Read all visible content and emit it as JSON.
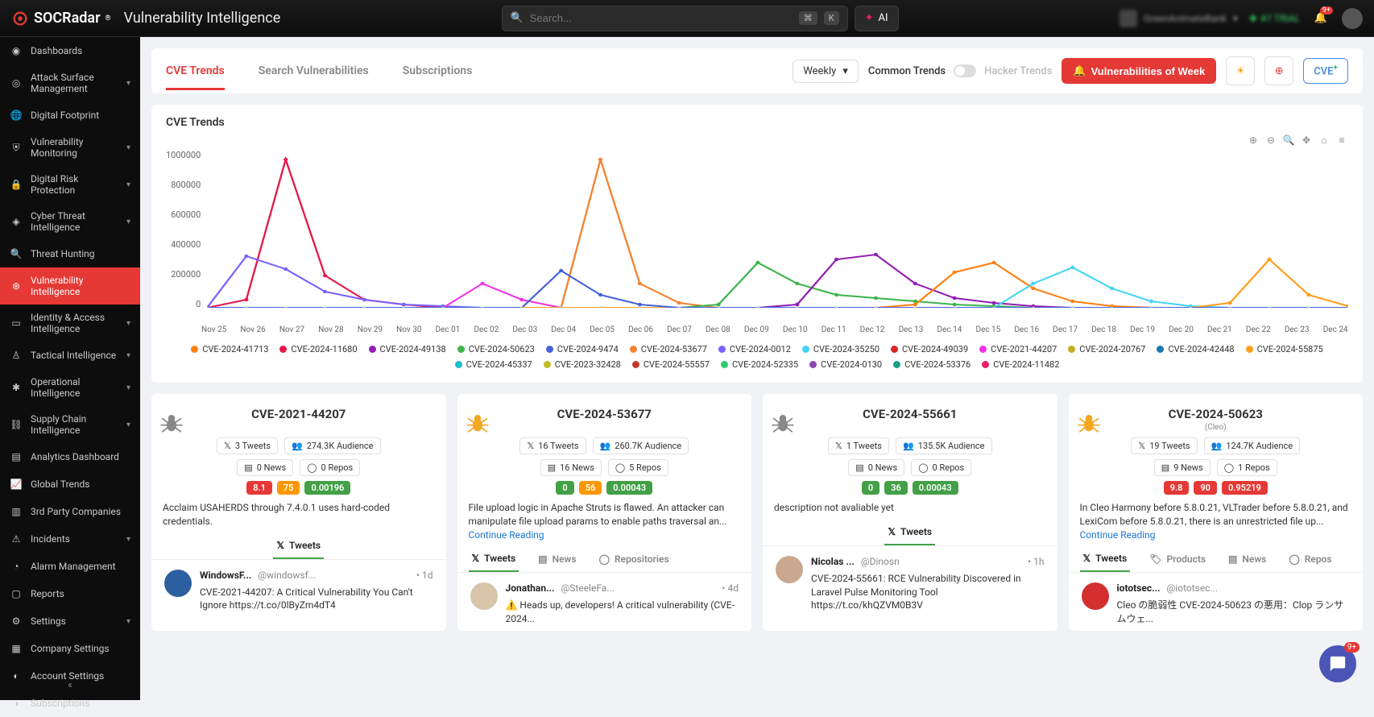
{
  "brand": "SOCRadar",
  "page_title": "Vulnerability Intelligence",
  "search": {
    "placeholder": "Search...",
    "kbd1": "⌘",
    "kbd2": "K",
    "ai": "AI"
  },
  "top": {
    "org": "GreenAnimateBank",
    "trial": "#7 TRIAL",
    "notif": "9+"
  },
  "sidebar": [
    {
      "label": "Dashboards",
      "icon": "gauge"
    },
    {
      "label": "Attack Surface Management",
      "icon": "target",
      "chev": true
    },
    {
      "label": "Digital Footprint",
      "icon": "globe"
    },
    {
      "label": "Vulnerability Monitoring",
      "icon": "shield",
      "chev": true
    },
    {
      "label": "Digital Risk Protection",
      "icon": "lock",
      "chev": true
    },
    {
      "label": "Cyber Threat Intelligence",
      "icon": "radar",
      "chev": true
    },
    {
      "label": "Threat Hunting",
      "icon": "search"
    },
    {
      "label": "Vulnerability Intelligence",
      "icon": "bug",
      "active": true
    },
    {
      "label": "Identity & Access Intelligence",
      "icon": "id",
      "chev": true
    },
    {
      "label": "Tactical Intelligence",
      "icon": "chess",
      "chev": true
    },
    {
      "label": "Operational Intelligence",
      "icon": "gear",
      "chev": true
    },
    {
      "label": "Supply Chain Intelligence",
      "icon": "link",
      "chev": true
    },
    {
      "label": "Analytics Dashboard",
      "icon": "chart"
    },
    {
      "label": "Global Trends",
      "icon": "trend"
    },
    {
      "label": "3rd Party Companies",
      "icon": "building"
    },
    {
      "label": "Incidents",
      "icon": "alert",
      "chev": true
    },
    {
      "label": "Alarm Management",
      "icon": "bell"
    },
    {
      "label": "Reports",
      "icon": "doc"
    },
    {
      "label": "Settings",
      "icon": "cog",
      "chev": true
    },
    {
      "label": "Company Settings",
      "icon": "company"
    },
    {
      "label": "Account Settings",
      "icon": "user"
    },
    {
      "label": "Subscriptions",
      "icon": "sub"
    }
  ],
  "tabs": {
    "items": [
      "CVE Trends",
      "Search Vulnerabilities",
      "Subscriptions"
    ],
    "active": 0
  },
  "controls": {
    "range": "Weekly",
    "common": "Common Trends",
    "hacker": "Hacker Trends",
    "vuln_week": "Vulnerabilities of Week",
    "cve": "CVE"
  },
  "chart": {
    "title": "CVE Trends",
    "y_ticks": [
      "1000000",
      "800000",
      "600000",
      "400000",
      "200000",
      "0"
    ],
    "x_ticks": [
      "Nov 25",
      "Nov 26",
      "Nov 27",
      "Nov 28",
      "Nov 29",
      "Nov 30",
      "Dec 01",
      "Dec 02",
      "Dec 03",
      "Dec 04",
      "Dec 05",
      "Dec 06",
      "Dec 07",
      "Dec 08",
      "Dec 09",
      "Dec 10",
      "Dec 11",
      "Dec 12",
      "Dec 13",
      "Dec 14",
      "Dec 15",
      "Dec 16",
      "Dec 17",
      "Dec 18",
      "Dec 19",
      "Dec 20",
      "Dec 21",
      "Dec 22",
      "Dec 23",
      "Dec 24"
    ],
    "legend": [
      {
        "label": "CVE-2024-41713",
        "color": "#ff7f0e"
      },
      {
        "label": "CVE-2024-11680",
        "color": "#e6194B"
      },
      {
        "label": "CVE-2024-49138",
        "color": "#911eb4"
      },
      {
        "label": "CVE-2024-50623",
        "color": "#3cb44b"
      },
      {
        "label": "CVE-2024-9474",
        "color": "#4363d8"
      },
      {
        "label": "CVE-2024-53677",
        "color": "#f58231"
      },
      {
        "label": "CVE-2024-0012",
        "color": "#7b61ff"
      },
      {
        "label": "CVE-2024-35250",
        "color": "#42d4f4"
      },
      {
        "label": "CVE-2024-49039",
        "color": "#d62728"
      },
      {
        "label": "CVE-2021-44207",
        "color": "#f032e6"
      },
      {
        "label": "CVE-2024-20767",
        "color": "#bfae1f"
      },
      {
        "label": "CVE-2024-42448",
        "color": "#1f77b4"
      },
      {
        "label": "CVE-2024-55875",
        "color": "#ff9e1b"
      },
      {
        "label": "CVE-2024-45337",
        "color": "#17becf"
      },
      {
        "label": "CVE-2023-32428",
        "color": "#bcbd22"
      },
      {
        "label": "CVE-2024-55557",
        "color": "#c0392b"
      },
      {
        "label": "CVE-2024-52335",
        "color": "#2ecc71"
      },
      {
        "label": "CVE-2024-0130",
        "color": "#8e44ad"
      },
      {
        "label": "CVE-2024-53376",
        "color": "#16a085"
      },
      {
        "label": "CVE-2024-11482",
        "color": "#e91e63"
      }
    ]
  },
  "chart_data": {
    "type": "line",
    "title": "CVE Trends",
    "xlabel": "",
    "ylabel": "",
    "ylim": [
      0,
      1000000
    ],
    "categories": [
      "Nov 25",
      "Nov 26",
      "Nov 27",
      "Nov 28",
      "Nov 29",
      "Nov 30",
      "Dec 01",
      "Dec 02",
      "Dec 03",
      "Dec 04",
      "Dec 05",
      "Dec 06",
      "Dec 07",
      "Dec 08",
      "Dec 09",
      "Dec 10",
      "Dec 11",
      "Dec 12",
      "Dec 13",
      "Dec 14",
      "Dec 15",
      "Dec 16",
      "Dec 17",
      "Dec 18",
      "Dec 19",
      "Dec 20",
      "Dec 21",
      "Dec 22",
      "Dec 23",
      "Dec 24"
    ],
    "series": [
      {
        "name": "CVE-2024-11680",
        "values": [
          0,
          50000,
          920000,
          200000,
          50000,
          20000,
          0,
          0,
          0,
          0,
          0,
          0,
          0,
          0,
          0,
          0,
          0,
          0,
          0,
          0,
          0,
          0,
          0,
          0,
          0,
          0,
          0,
          0,
          0,
          0
        ]
      },
      {
        "name": "CVE-2024-53677",
        "values": [
          0,
          0,
          0,
          0,
          0,
          0,
          0,
          0,
          0,
          0,
          920000,
          150000,
          30000,
          0,
          0,
          0,
          0,
          0,
          0,
          0,
          0,
          0,
          0,
          0,
          0,
          0,
          0,
          0,
          0,
          0
        ]
      },
      {
        "name": "CVE-2024-0012",
        "values": [
          0,
          320000,
          240000,
          100000,
          50000,
          20000,
          10000,
          0,
          0,
          0,
          0,
          0,
          0,
          0,
          0,
          0,
          0,
          0,
          0,
          0,
          0,
          0,
          0,
          0,
          0,
          0,
          0,
          0,
          0,
          0
        ]
      },
      {
        "name": "CVE-2024-50623",
        "values": [
          0,
          0,
          0,
          0,
          0,
          0,
          0,
          0,
          0,
          0,
          0,
          0,
          0,
          20000,
          280000,
          150000,
          80000,
          60000,
          40000,
          20000,
          10000,
          0,
          0,
          0,
          0,
          0,
          0,
          0,
          0,
          0
        ]
      },
      {
        "name": "CVE-2024-49138",
        "values": [
          0,
          0,
          0,
          0,
          0,
          0,
          0,
          0,
          0,
          0,
          0,
          0,
          0,
          0,
          0,
          20000,
          300000,
          330000,
          150000,
          60000,
          30000,
          10000,
          0,
          0,
          0,
          0,
          0,
          0,
          0,
          0
        ]
      },
      {
        "name": "CVE-2021-44207",
        "values": [
          0,
          0,
          0,
          0,
          0,
          0,
          0,
          150000,
          50000,
          0,
          0,
          0,
          0,
          0,
          0,
          0,
          0,
          0,
          0,
          0,
          0,
          0,
          0,
          0,
          0,
          0,
          0,
          0,
          0,
          0
        ]
      },
      {
        "name": "CVE-2024-41713",
        "values": [
          0,
          0,
          0,
          0,
          0,
          0,
          0,
          0,
          0,
          0,
          0,
          0,
          0,
          0,
          0,
          0,
          0,
          0,
          20000,
          220000,
          280000,
          120000,
          40000,
          10000,
          0,
          0,
          0,
          0,
          0,
          0
        ]
      },
      {
        "name": "CVE-2024-35250",
        "values": [
          0,
          0,
          0,
          0,
          0,
          0,
          0,
          0,
          0,
          0,
          0,
          0,
          0,
          0,
          0,
          0,
          0,
          0,
          0,
          0,
          0,
          150000,
          250000,
          120000,
          40000,
          10000,
          0,
          0,
          0,
          0
        ]
      },
      {
        "name": "CVE-2024-55875",
        "values": [
          0,
          0,
          0,
          0,
          0,
          0,
          0,
          0,
          0,
          0,
          0,
          0,
          0,
          0,
          0,
          0,
          0,
          0,
          0,
          0,
          0,
          0,
          0,
          0,
          0,
          0,
          30000,
          300000,
          80000,
          10000
        ]
      },
      {
        "name": "CVE-2024-9474",
        "values": [
          0,
          0,
          0,
          0,
          0,
          0,
          0,
          0,
          0,
          230000,
          80000,
          20000,
          0,
          0,
          0,
          0,
          0,
          0,
          0,
          0,
          0,
          0,
          0,
          0,
          0,
          0,
          0,
          0,
          0,
          0
        ]
      }
    ]
  },
  "cards": [
    {
      "id": "CVE-2021-44207",
      "sub": "",
      "spider": "#888",
      "tweets": "3 Tweets",
      "audience": "274.3K Audience",
      "news": "0 News",
      "repos": "0 Repos",
      "p1": {
        "v": "8.1",
        "c": "red"
      },
      "p2": {
        "v": "75",
        "c": "orange"
      },
      "p3": {
        "v": "0.00196",
        "c": "green"
      },
      "desc": "Acclaim USAHERDS through 7.4.0.1 uses hard-coded credentials.",
      "cont": false,
      "card_tabs": [
        {
          "l": "Tweets",
          "icon": "x",
          "active": true
        }
      ],
      "tabs_center": true,
      "tweet": {
        "name": "WindowsF...",
        "handle": "@windowsf...",
        "age": "1d",
        "body": "CVE-2021-44207: A Critical Vulnerability You Can't Ignore https://t.co/0lByZm4dT4",
        "ava": "#2c5fa0"
      }
    },
    {
      "id": "CVE-2024-53677",
      "sub": "",
      "spider": "#f5a623",
      "tweets": "16 Tweets",
      "audience": "260.7K Audience",
      "news": "16 News",
      "repos": "5 Repos",
      "p1": {
        "v": "0",
        "c": "green"
      },
      "p2": {
        "v": "56",
        "c": "orange"
      },
      "p3": {
        "v": "0.00043",
        "c": "green"
      },
      "desc": "File upload logic in Apache Struts is flawed. An attacker can manipulate file upload params to enable paths traversal an... ",
      "cont": true,
      "card_tabs": [
        {
          "l": "Tweets",
          "icon": "x",
          "active": true
        },
        {
          "l": "News",
          "icon": "news"
        },
        {
          "l": "Repositories",
          "icon": "gh"
        }
      ],
      "tweet": {
        "name": "Jonathan...",
        "handle": "@SteeleFa...",
        "age": "4d",
        "body": "⚠️ Heads up, developers! A critical vulnerability (CVE-2024...",
        "ava": "#d8c4a8"
      }
    },
    {
      "id": "CVE-2024-55661",
      "sub": "",
      "spider": "#888",
      "tweets": "1 Tweets",
      "audience": "135.5K Audience",
      "news": "0 News",
      "repos": "0 Repos",
      "p1": {
        "v": "0",
        "c": "green"
      },
      "p2": {
        "v": "36",
        "c": "green"
      },
      "p3": {
        "v": "0.00043",
        "c": "green"
      },
      "desc": "description not avaliable yet",
      "cont": false,
      "card_tabs": [
        {
          "l": "Tweets",
          "icon": "x",
          "active": true
        }
      ],
      "tabs_center": true,
      "tweet": {
        "name": "Nicolas ...",
        "handle": "@Dinosn",
        "age": "1h",
        "body": "CVE-2024-55661: RCE Vulnerability Discovered in Laravel Pulse Monitoring Tool https://t.co/khQZVM0B3V",
        "ava": "#c9a88f"
      }
    },
    {
      "id": "CVE-2024-50623",
      "sub": "(Cleo)",
      "spider": "#f5a623",
      "tweets": "19 Tweets",
      "audience": "124.7K Audience",
      "news": "9 News",
      "repos": "1 Repos",
      "p1": {
        "v": "9.8",
        "c": "red"
      },
      "p2": {
        "v": "90",
        "c": "red"
      },
      "p3": {
        "v": "0.95219",
        "c": "red"
      },
      "desc": "In Cleo Harmony before 5.8.0.21, VLTrader before 5.8.0.21, and LexiCom before 5.8.0.21, there is an unrestricted file up... ",
      "cont": true,
      "card_tabs": [
        {
          "l": "Tweets",
          "icon": "x",
          "active": true
        },
        {
          "l": "Products",
          "icon": "tag"
        },
        {
          "l": "News",
          "icon": "news"
        },
        {
          "l": "Repos",
          "icon": "gh"
        }
      ],
      "tweet": {
        "name": "iototsec...",
        "handle": "@iototsec...",
        "age": "",
        "body": "Cleo の脆弱性 CVE-2024-50623 の悪用：Clop ランサムウェ...",
        "ava": "#d32f2f"
      }
    }
  ],
  "labels": {
    "continue": "Continue Reading",
    "tweets": "Tweets"
  },
  "fab": "9+"
}
